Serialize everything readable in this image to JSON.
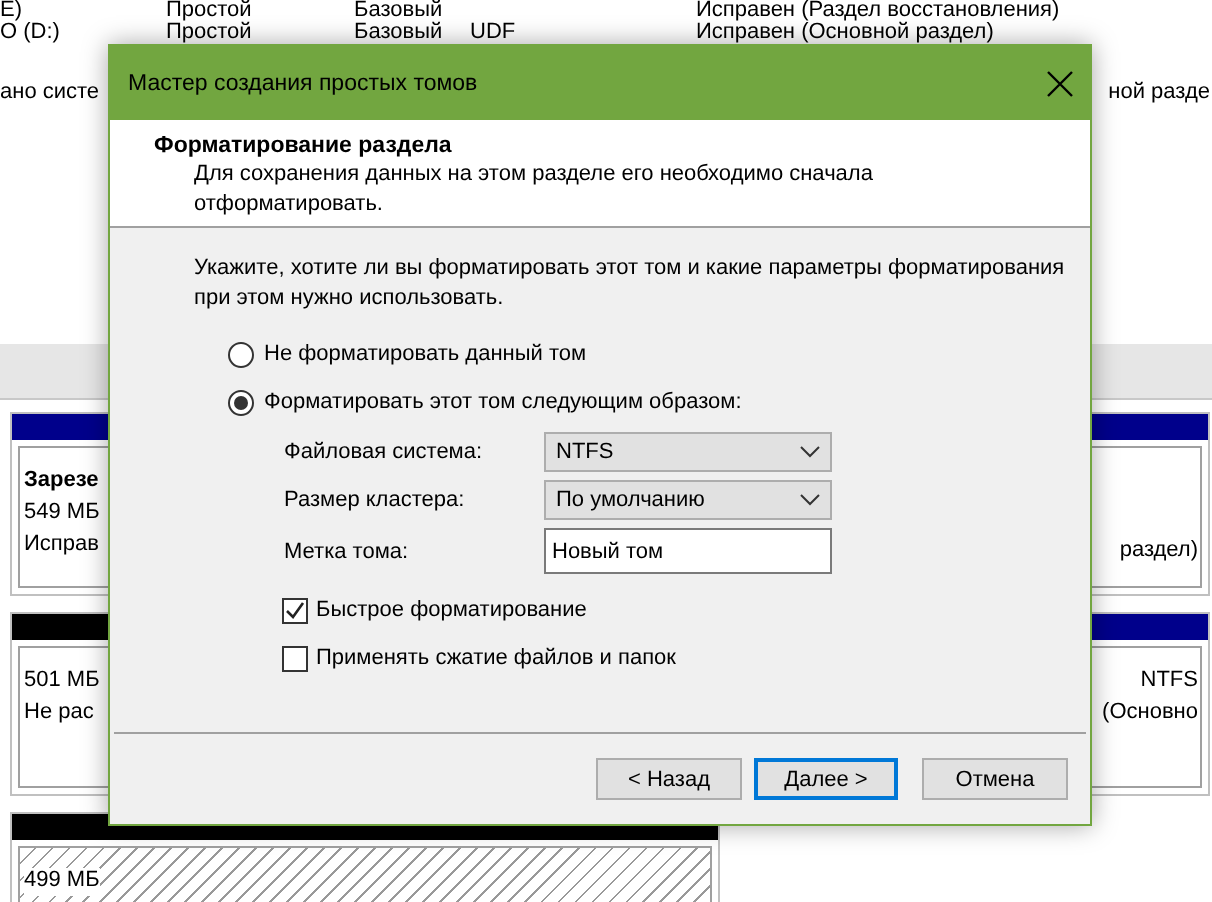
{
  "background": {
    "volume_rows": [
      {
        "volume": "E)",
        "layout": "Простой",
        "type": "Базовый",
        "status": "Исправен (Раздел восстановления)"
      },
      {
        "volume": "О (D:)",
        "layout": "Простой",
        "type": "Базовый",
        "filesystem": "UDF",
        "status": "Исправен (Основной раздел)"
      },
      {
        "volume": "ано систе",
        "status_tail": "ной разде"
      }
    ],
    "disks": [
      {
        "partitions": [
          {
            "kind": "primary",
            "selected": false,
            "lines": [
              "Зарезе",
              "549 МБ",
              "Исправ"
            ]
          },
          {
            "kind": "primary",
            "selected": false,
            "lines": [
              "раздел)"
            ]
          }
        ]
      },
      {
        "partitions": [
          {
            "kind": "unallocated",
            "selected": false,
            "lines": [
              "501 МБ",
              "Не рас"
            ]
          },
          {
            "kind": "primary",
            "selected": false,
            "lines": [
              "NTFS",
              "(Основно"
            ]
          }
        ]
      },
      {
        "partitions": [
          {
            "kind": "unallocated",
            "selected": true,
            "lines": [
              "499 МБ"
            ]
          }
        ]
      }
    ]
  },
  "dialog": {
    "title": "Мастер создания простых томов",
    "header": {
      "title": "Форматирование раздела",
      "description": "Для сохранения данных на этом разделе его необходимо сначала отформатировать."
    },
    "intro": "Укажите, хотите ли вы форматировать этот том и какие параметры форматирования при этом нужно использовать.",
    "radios": [
      {
        "label": "Не форматировать данный том",
        "selected": false
      },
      {
        "label": "Форматировать этот том следующим образом:",
        "selected": true
      }
    ],
    "fields": [
      {
        "kind": "select",
        "label": "Файловая система:",
        "value": "NTFS"
      },
      {
        "kind": "select",
        "label": "Размер кластера:",
        "value": "По умолчанию"
      },
      {
        "kind": "text",
        "label": "Метка тома:",
        "value": "Новый том"
      }
    ],
    "checkboxes": [
      {
        "label": "Быстрое форматирование",
        "checked": true
      },
      {
        "label": "Применять сжатие файлов и папок",
        "checked": false
      }
    ],
    "buttons": [
      {
        "label": "< Назад",
        "default": false
      },
      {
        "label": "Далее >",
        "default": true
      },
      {
        "label": "Отмена",
        "default": false
      }
    ]
  }
}
